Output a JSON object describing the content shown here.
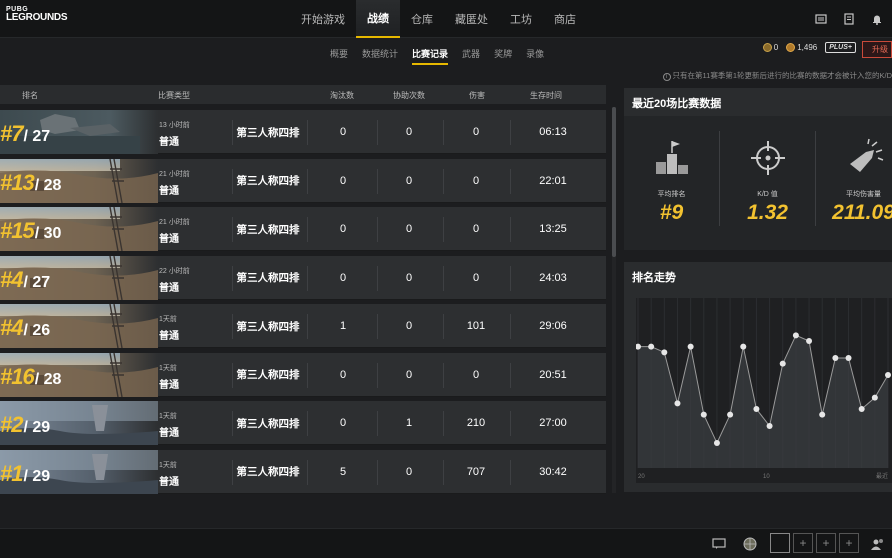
{
  "logo": {
    "line1": "PUBG",
    "line2": "LEGROUNDS"
  },
  "nav": {
    "tabs": [
      {
        "label": "开始游戏",
        "active": false
      },
      {
        "label": "战绩",
        "active": true
      },
      {
        "label": "仓库",
        "active": false
      },
      {
        "label": "藏匿处",
        "active": false
      },
      {
        "label": "工坊",
        "active": false
      },
      {
        "label": "商店",
        "active": false
      }
    ]
  },
  "top_icons": [
    "news-icon",
    "mission-icon",
    "bell-icon"
  ],
  "subnav": {
    "tabs": [
      {
        "label": "概要",
        "active": false
      },
      {
        "label": "数据统计",
        "active": false
      },
      {
        "label": "比赛记录",
        "active": true
      },
      {
        "label": "武器",
        "active": false
      },
      {
        "label": "奖牌",
        "active": false
      },
      {
        "label": "录像",
        "active": false
      }
    ]
  },
  "currency": {
    "bp": "0",
    "gcoin": "1,496",
    "plus": "PLUS+",
    "upgrade": "升级"
  },
  "notice": "只有在第11赛季第1轮更新后进行的比赛的数据才会被计入您的K/D",
  "table": {
    "headers": {
      "rank": "排名",
      "type": "比赛类型",
      "kills": "淘汰数",
      "assists": "协助次数",
      "damage": "伤害",
      "survival": "生存时间"
    },
    "rows": [
      {
        "rank": "#7",
        "total": "/ 27",
        "ago": "13 小时前",
        "type": "普通",
        "mode": "第三人称四排",
        "kills": "0",
        "assists": "0",
        "damage": "0",
        "time": "06:13",
        "map": "water"
      },
      {
        "rank": "#13",
        "total": "/ 28",
        "ago": "21 小时前",
        "type": "普通",
        "mode": "第三人称四排",
        "kills": "0",
        "assists": "0",
        "damage": "0",
        "time": "22:01",
        "map": "desert"
      },
      {
        "rank": "#15",
        "total": "/ 30",
        "ago": "21 小时前",
        "type": "普通",
        "mode": "第三人称四排",
        "kills": "0",
        "assists": "0",
        "damage": "0",
        "time": "13:25",
        "map": "desert"
      },
      {
        "rank": "#4",
        "total": "/ 27",
        "ago": "22 小时前",
        "type": "普通",
        "mode": "第三人称四排",
        "kills": "0",
        "assists": "0",
        "damage": "0",
        "time": "24:03",
        "map": "desert"
      },
      {
        "rank": "#4",
        "total": "/ 26",
        "ago": "1天前",
        "type": "普通",
        "mode": "第三人称四排",
        "kills": "1",
        "assists": "0",
        "damage": "101",
        "time": "29:06",
        "map": "desert"
      },
      {
        "rank": "#16",
        "total": "/ 28",
        "ago": "1天前",
        "type": "普通",
        "mode": "第三人称四排",
        "kills": "0",
        "assists": "0",
        "damage": "0",
        "time": "20:51",
        "map": "desert"
      },
      {
        "rank": "#2",
        "total": "/ 29",
        "ago": "1天前",
        "type": "普通",
        "mode": "第三人称四排",
        "kills": "0",
        "assists": "1",
        "damage": "210",
        "time": "27:00",
        "map": "tower"
      },
      {
        "rank": "#1",
        "total": "/ 29",
        "ago": "1天前",
        "type": "普通",
        "mode": "第三人称四排",
        "kills": "5",
        "assists": "0",
        "damage": "707",
        "time": "30:42",
        "map": "tower"
      }
    ]
  },
  "recent": {
    "title": "最近20场比赛数据",
    "stats": [
      {
        "label": "平均排名",
        "value": "#9",
        "icon": "podium-icon"
      },
      {
        "label": "K/D 值",
        "value": "1.32",
        "icon": "crosshair-icon"
      },
      {
        "label": "平均伤害量",
        "value": "211.09",
        "icon": "bullet-icon"
      }
    ]
  },
  "trend": {
    "title": "排名走势",
    "x_labels": [
      "20",
      "10",
      "最近"
    ]
  },
  "chart_data": {
    "type": "line",
    "title": "排名走势",
    "x_tick_labels": [
      "20",
      "10",
      "最近"
    ],
    "y_inverted": true,
    "grid": true,
    "series": [
      {
        "values": [
          4,
          4,
          5,
          14,
          4,
          16,
          21,
          16,
          4,
          15,
          18,
          7,
          2,
          3,
          16,
          6,
          6,
          15,
          13,
          9
        ]
      }
    ]
  },
  "bottom": {
    "icons": [
      "chat-icon",
      "globe-icon",
      "friends-icon"
    ]
  },
  "colors": {
    "accent": "#f2c230",
    "background": "#1c1d1f",
    "upgrade": "#c94a3a"
  }
}
